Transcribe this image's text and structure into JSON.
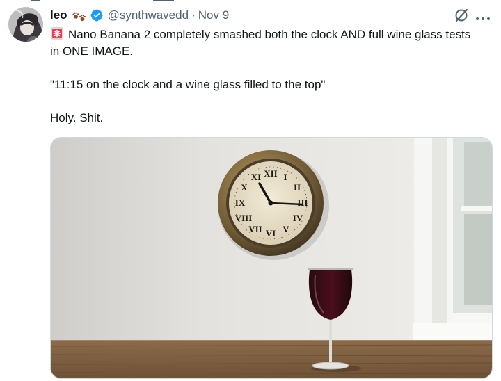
{
  "tweet": {
    "author_name": "leo",
    "handle": "@synthwavedd",
    "separator": "·",
    "date": "Nov 9",
    "text_line1": "Nano Banana 2 completely smashed both the clock AND full wine glass tests in ONE IMAGE.",
    "text_quote": "\"11:15 on the clock and a wine glass filled to the top\"",
    "text_line3": "Holy. Shit."
  },
  "icons": {
    "author_emoji": "paw-prints-icon",
    "badge": "verified-badge-icon",
    "text_emoji": "police-siren-icon",
    "grok": "grok-icon",
    "more": "more-icon"
  },
  "colors": {
    "text_primary": "#0f1419",
    "text_secondary": "#536471",
    "verified_blue": "#1d9bf0",
    "border": "#cfd9de"
  },
  "media": {
    "kind": "photo",
    "subject": "wall clock and red wine glass on a wooden table",
    "clock_reading": "11:15"
  }
}
